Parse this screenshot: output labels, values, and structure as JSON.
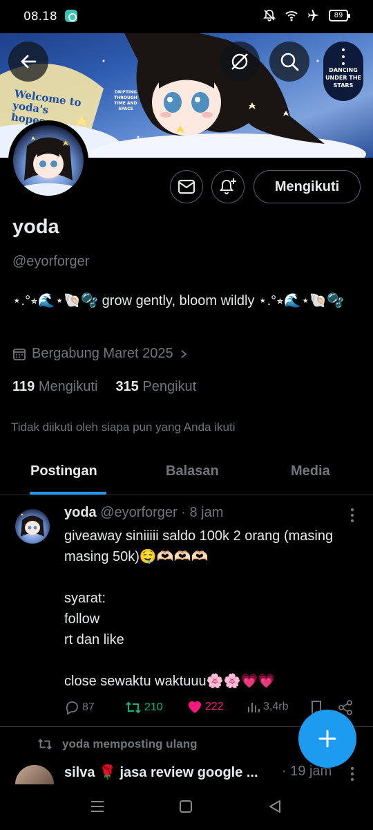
{
  "status_bar": {
    "time": "08.18",
    "battery": "89",
    "icons": [
      "app-notification-icon",
      "mute-bell-icon",
      "wifi-icon",
      "airplane-icon",
      "battery-icon"
    ]
  },
  "banner": {
    "welcome_text": "Welcome to yoda's hopes",
    "drift_text": "DRIFTING THROUGH TIME AND SPACE",
    "dancing_text": "DANCING UNDER THE STARS"
  },
  "header_buttons": {
    "back": "back-arrow-icon",
    "grok": "no-grok-icon",
    "search": "search-icon",
    "more": "more-vertical-icon"
  },
  "profile": {
    "follow_label": "Mengikuti",
    "name": "yoda",
    "handle": "@eyorforger",
    "bio": "⋆.°⭒🌊⋆🐚🫧 grow gently, bloom wildly ⋆.°⭒🌊⋆🐚🫧",
    "joined": "Bergabung Maret 2025",
    "following_count": "119",
    "following_label": "Mengikuti",
    "followers_count": "315",
    "followers_label": "Pengikut",
    "not_followed": "Tidak diikuti oleh siapa pun yang Anda ikuti"
  },
  "tabs": [
    {
      "label": "Postingan",
      "active": true
    },
    {
      "label": "Balasan",
      "active": false
    },
    {
      "label": "Media",
      "active": false
    }
  ],
  "post": {
    "name": "yoda",
    "handle": "@eyorforger",
    "time": "· 8 jam",
    "text": "giveaway siniiiii saldo 100k 2 orang (masing masing 50k)🤤🫶🏻🫶🏻🫶🏻\n\nsyarat:\nfollow\nrt dan like\n\nclose sewaktu waktuuu🌸🌸💗💗",
    "replies": "87",
    "reposts": "210",
    "likes": "222",
    "views": "3,4rb"
  },
  "repost_item": {
    "repost_label": "yoda memposting ulang",
    "name": "silva 🌹 jasa review google ...",
    "time": "· 19 jam"
  },
  "colors": {
    "accent": "#1d9bf0",
    "repost": "#00ba7c",
    "like": "#f91880",
    "muted": "#71767b"
  }
}
